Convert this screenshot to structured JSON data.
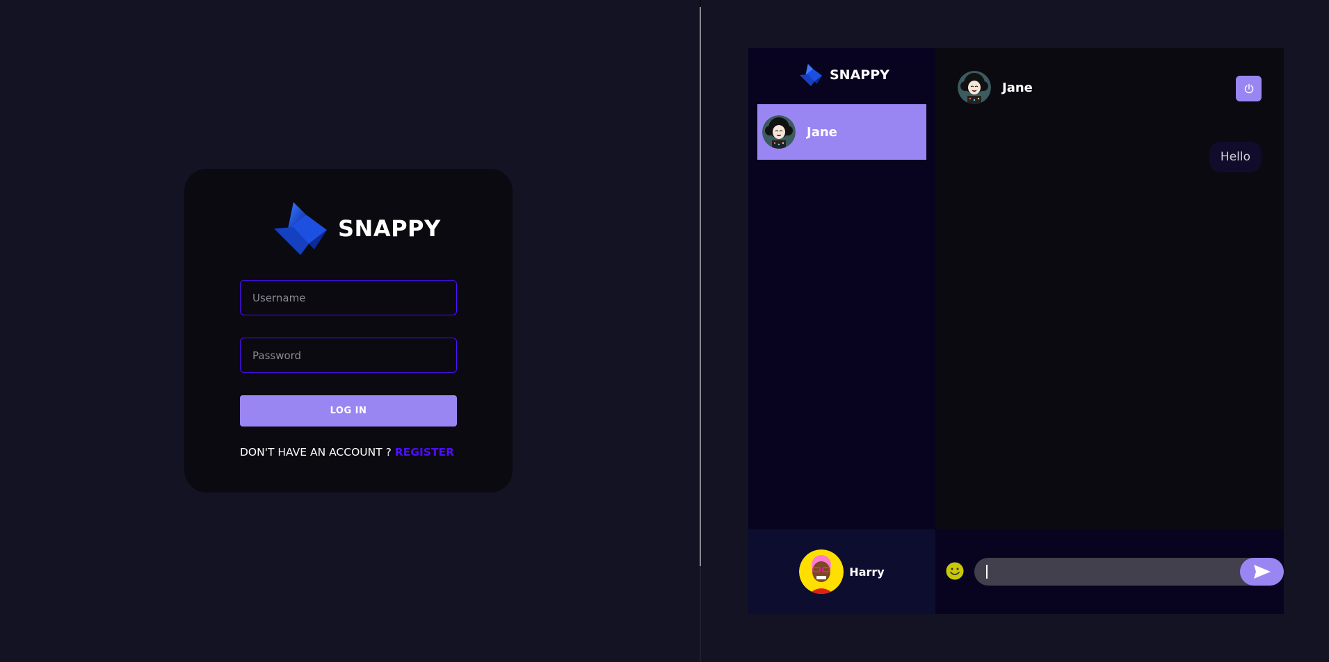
{
  "login": {
    "brand_name": "SNAPPY",
    "username_placeholder": "Username",
    "password_placeholder": "Password",
    "login_label": "LOG IN",
    "register_prompt": "DON'T HAVE AN ACCOUNT ?",
    "register_link": "REGISTER"
  },
  "chat": {
    "brand_name": "SNAPPY",
    "contacts": [
      {
        "name": "Jane",
        "selected": true
      }
    ],
    "current_user": {
      "name": "Harry"
    },
    "header": {
      "peer_name": "Jane",
      "logout_icon": "power-icon"
    },
    "messages": [
      {
        "text": "Hello",
        "direction": "sent"
      }
    ],
    "input": {
      "placeholder": "",
      "value": ""
    }
  },
  "colors": {
    "background": "#131324",
    "card": "#0b0a11",
    "accent": "#9a86f3",
    "link": "#4e0eff",
    "sidebar": "#080420"
  }
}
